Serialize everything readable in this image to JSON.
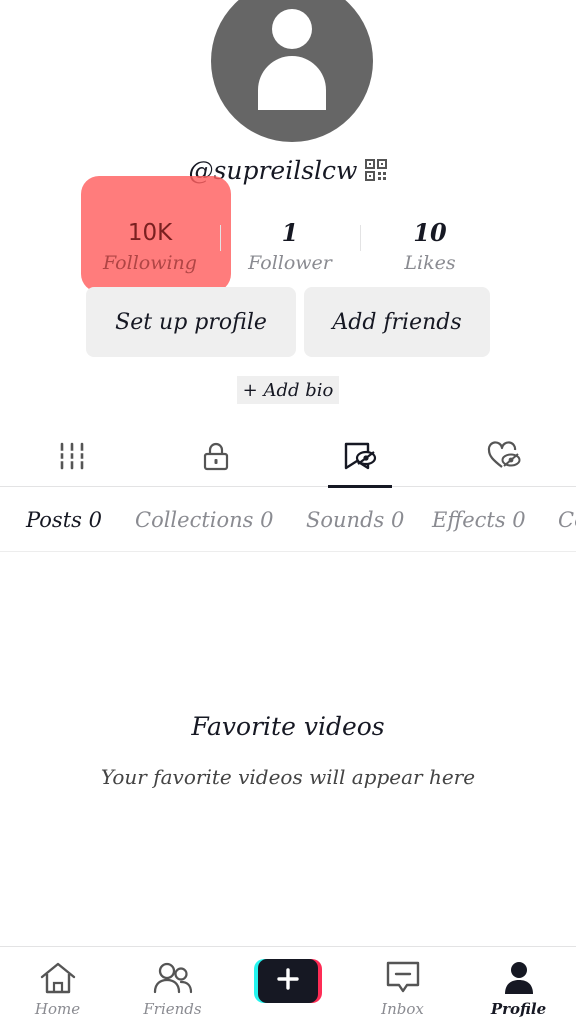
{
  "profile": {
    "username": "@supreilslcw",
    "avatar_icon": "default-avatar-icon"
  },
  "stats": [
    {
      "value": "10K",
      "label": "Following"
    },
    {
      "value": "1",
      "label": "Follower"
    },
    {
      "value": "10",
      "label": "Likes"
    }
  ],
  "actions": {
    "setup_label": "Set up profile",
    "add_friends_label": "Add friends",
    "add_bio_label": "+ Add bio"
  },
  "icon_tabs": [
    {
      "icon": "grid-icon"
    },
    {
      "icon": "lock-icon"
    },
    {
      "icon": "bookmark-hidden-icon",
      "active": true
    },
    {
      "icon": "heart-hidden-icon"
    }
  ],
  "sub_tabs": [
    {
      "label": "Posts 0",
      "active": true
    },
    {
      "label": "Collections 0"
    },
    {
      "label": "Sounds 0"
    },
    {
      "label": "Effects 0"
    },
    {
      "label": "Co"
    }
  ],
  "empty_state": {
    "title": "Favorite videos",
    "subtitle": "Your favorite videos will appear here"
  },
  "bottom_nav": [
    {
      "label": "Home",
      "icon": "home-icon"
    },
    {
      "label": "Friends",
      "icon": "friends-icon"
    },
    {
      "label": "",
      "icon": "plus-icon"
    },
    {
      "label": "Inbox",
      "icon": "inbox-icon"
    },
    {
      "label": "Profile",
      "icon": "profile-icon",
      "active": true
    }
  ],
  "colors": {
    "highlight": "#ff5f5f",
    "text_primary": "#161823",
    "text_secondary": "#8a8b91",
    "accent_cyan": "#25f4ee",
    "accent_red": "#fe2c55"
  }
}
